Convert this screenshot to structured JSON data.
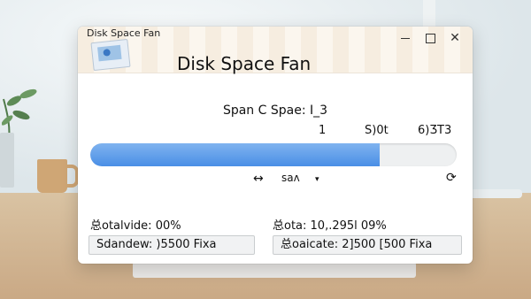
{
  "window": {
    "title_small": "Disk Space Fan",
    "app_title": "Disk Space Fan",
    "icon": "app-monitor-icon"
  },
  "controls": {
    "minimize_icon": "minimize-icon",
    "maximize_icon": "maximize-icon",
    "close_glyph": "✕"
  },
  "scan": {
    "label": "Span C Spae: I_3",
    "scale": [
      "1",
      "S)0t",
      "6)ӠT3"
    ],
    "progress": 0.79,
    "progress_color": "#4a8fe6"
  },
  "toolbar": {
    "arrows_glyph": "↔",
    "label": "saʌ",
    "dropdown_glyph": "▾",
    "refresh_glyph": "⟳"
  },
  "stats": {
    "left_label": "总otalvide: 00%",
    "right_label": "总ota: 10,.295l 09%",
    "left_box": "Sdandew: )5500 Fixa",
    "right_box": "总oaicate: 2]500 [500 Fixa"
  }
}
